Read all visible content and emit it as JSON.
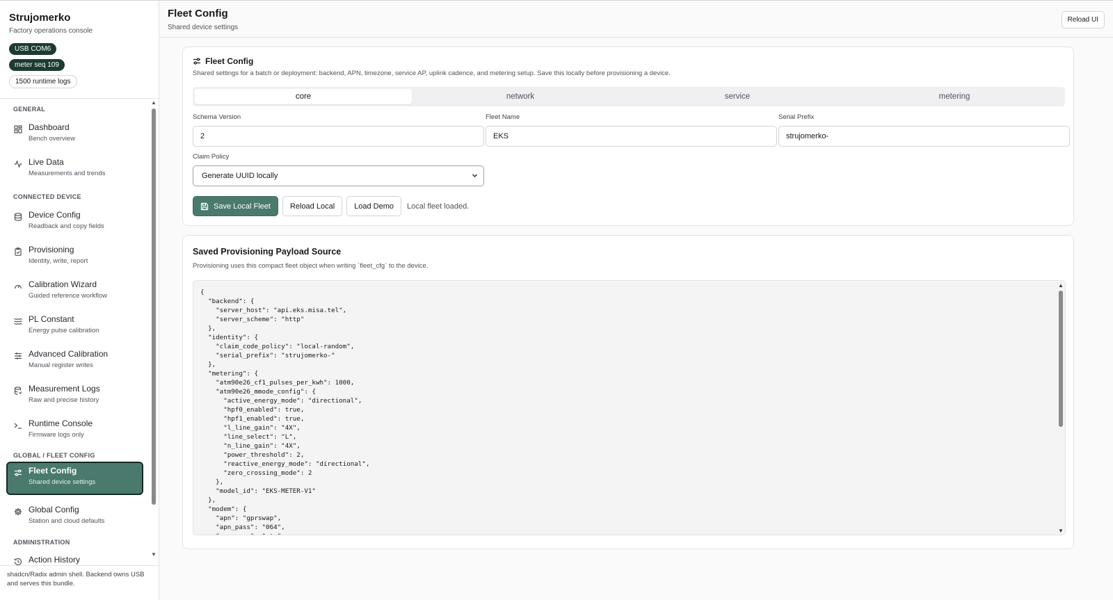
{
  "sidebar": {
    "brand_title": "Strujomerko",
    "brand_sub": "Factory operations console",
    "badges": {
      "usb": "USB COM6",
      "meter_seq": "meter seq 109",
      "logs": "1500 runtime logs"
    },
    "sections": {
      "general": "GENERAL",
      "connected": "CONNECTED DEVICE",
      "global": "GLOBAL / FLEET CONFIG",
      "admin": "ADMINISTRATION"
    },
    "items": [
      {
        "title": "Dashboard",
        "sub": "Bench overview",
        "icon": "grid-icon"
      },
      {
        "title": "Live Data",
        "sub": "Measurements and trends",
        "icon": "activity-icon"
      },
      {
        "title": "Device Config",
        "sub": "Readback and copy fields",
        "icon": "database-icon"
      },
      {
        "title": "Provisioning",
        "sub": "Identity, write, report",
        "icon": "clipboard-icon"
      },
      {
        "title": "Calibration Wizard",
        "sub": "Guided reference workflow",
        "icon": "gauge-icon"
      },
      {
        "title": "PL Constant",
        "sub": "Energy pulse calibration",
        "icon": "waves-icon"
      },
      {
        "title": "Advanced Calibration",
        "sub": "Manual register writes",
        "icon": "sliders-icon"
      },
      {
        "title": "Measurement Logs",
        "sub": "Raw and precise history",
        "icon": "database-log-icon"
      },
      {
        "title": "Runtime Console",
        "sub": "Firmware logs only",
        "icon": "terminal-icon"
      },
      {
        "title": "Fleet Config",
        "sub": "Shared device settings",
        "icon": "settings-sliders-icon"
      },
      {
        "title": "Global Config",
        "sub": "Station and cloud defaults",
        "icon": "gear-icon"
      }
    ],
    "partial_item": "Action History",
    "footer": "shadcn/Radix admin shell. Backend owns USB and serves this bundle."
  },
  "header": {
    "title": "Fleet Config",
    "subtitle": "Shared device settings",
    "reload_ui": "Reload UI"
  },
  "fleet_card": {
    "title": "Fleet Config",
    "description": "Shared settings for a batch or deployment: backend, APN, timezone, service AP, uplink cadence, and metering setup. Save this locally before provisioning a device.",
    "tabs": [
      "core",
      "network",
      "service",
      "metering"
    ],
    "active_tab": "core",
    "fields": {
      "schema_version": {
        "label": "Schema Version",
        "value": "2"
      },
      "fleet_name": {
        "label": "Fleet Name",
        "value": "EKS"
      },
      "serial_prefix": {
        "label": "Serial Prefix",
        "value": "strujomerko-"
      },
      "claim_policy": {
        "label": "Claim Policy",
        "value": "Generate UUID locally"
      }
    },
    "buttons": {
      "save": "Save Local Fleet",
      "reload": "Reload Local",
      "demo": "Load Demo"
    },
    "status": "Local fleet loaded."
  },
  "payload_card": {
    "title": "Saved Provisioning Payload Source",
    "description": "Provisioning uses this compact fleet object when writing `fleet_cfg` to the device.",
    "json_text": "{\n  \"backend\": {\n    \"server_host\": \"api.eks.misa.tel\",\n    \"server_scheme\": \"http\"\n  },\n  \"identity\": {\n    \"claim_code_policy\": \"local-random\",\n    \"serial_prefix\": \"strujomerko-\"\n  },\n  \"metering\": {\n    \"atm90e26_cf1_pulses_per_kwh\": 1000,\n    \"atm90e26_mmode_config\": {\n      \"active_energy_mode\": \"directional\",\n      \"hpf0_enabled\": true,\n      \"hpf1_enabled\": true,\n      \"l_line_gain\": \"4X\",\n      \"line_select\": \"L\",\n      \"n_line_gain\": \"4X\",\n      \"power_threshold\": 2,\n      \"reactive_energy_mode\": \"directional\",\n      \"zero_crossing_mode\": 2\n    },\n    \"model_id\": \"EKS-METER-V1\"\n  },\n  \"modem\": {\n    \"apn\": \"gprswap\",\n    \"apn_pass\": \"064\",\n    \"apn_user\": \"mts\""
  }
}
